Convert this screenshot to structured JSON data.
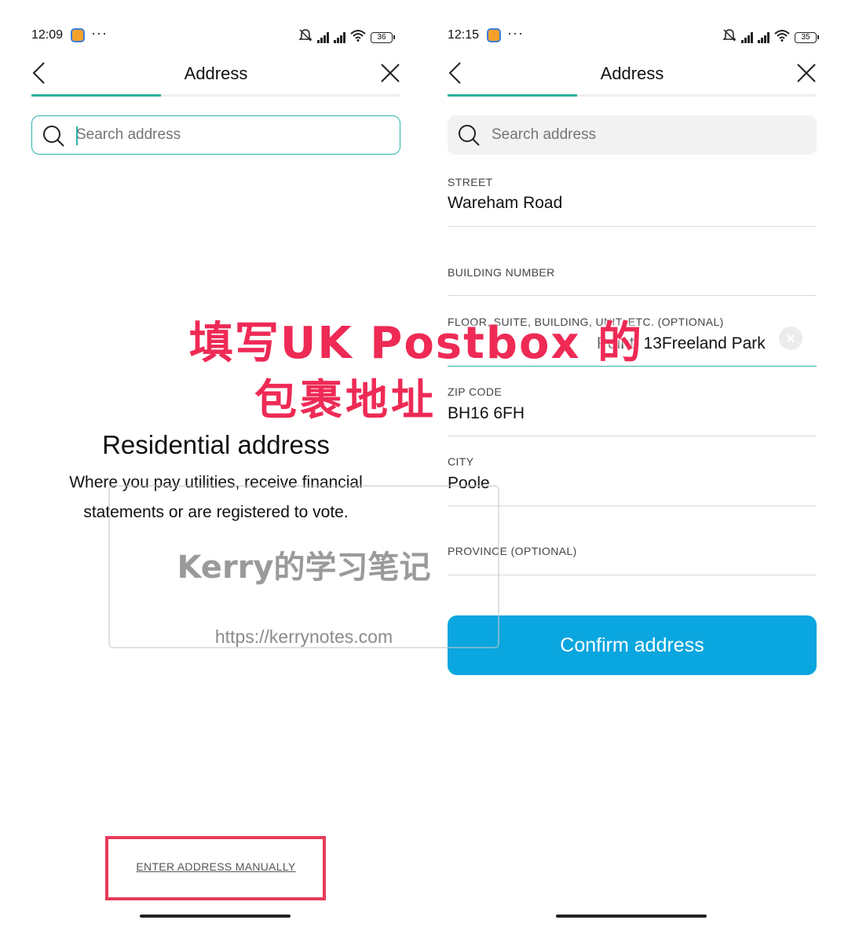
{
  "left_screen": {
    "status": {
      "time": "12:09",
      "battery": "36"
    },
    "header": {
      "title": "Address",
      "progress_fraction": 0.35
    },
    "search": {
      "placeholder": "Search address"
    },
    "residential": {
      "title": "Residential address",
      "line1": "Where you pay utilities, receive financial",
      "line2": "statements or are registered to vote."
    },
    "manual_link": "ENTER ADDRESS MANUALLY"
  },
  "right_screen": {
    "status": {
      "time": "12:15",
      "battery": "35"
    },
    "header": {
      "title": "Address",
      "progress_fraction": 0.35
    },
    "search": {
      "placeholder": "Search address"
    },
    "fields": {
      "street": {
        "label": "STREET",
        "value": "Wareham Road"
      },
      "building": {
        "label": "BUILDING NUMBER",
        "value": ""
      },
      "floor": {
        "label": "FLOOR, SUITE, BUILDING, UNIT, ETC. (OPTIONAL)",
        "value": "Point, 13Freeland Park"
      },
      "zip": {
        "label": "ZIP CODE",
        "value": "BH16 6FH"
      },
      "city": {
        "label": "CITY",
        "value": "Poole"
      },
      "province": {
        "label": "PROVINCE (OPTIONAL)",
        "value": ""
      }
    },
    "confirm_label": "Confirm address"
  },
  "overlay": {
    "caption_line1": "填写UK Postbox 的",
    "caption_line2": "包裹地址",
    "watermark_title": "Kerry的学习笔记",
    "watermark_url": "https://kerrynotes.com"
  },
  "colors": {
    "accent_teal": "#2bb3a7",
    "confirm_blue": "#0aa6df",
    "caption_red": "#ee2a55",
    "highlight_red": "#e83b5b"
  }
}
